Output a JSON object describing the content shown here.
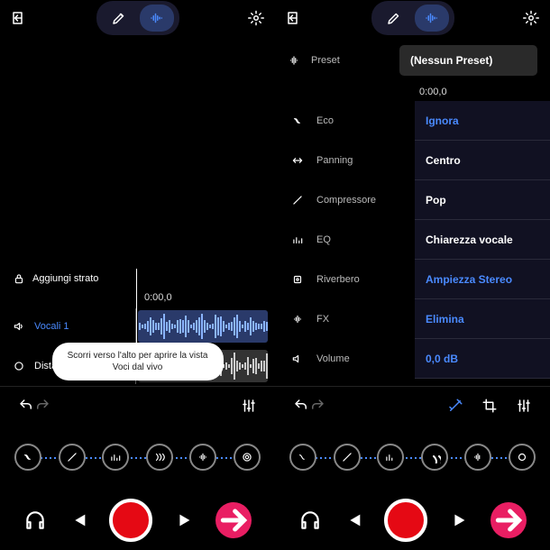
{
  "left": {
    "layer_header": "Aggiungi strato",
    "time": "0:00,0",
    "tracks": [
      {
        "name": "Vocali 1",
        "accent": true
      },
      {
        "name": "Distanza.WMA",
        "accent": false
      }
    ],
    "tooltip": "Scorri verso l'alto per aprire la vista Voci dal vivo"
  },
  "right": {
    "preset_label": "Preset",
    "preset_value": "(Nessun Preset)",
    "time": "0:00,0",
    "fx": [
      {
        "name": "Eco",
        "value": "Ignora",
        "accent": true
      },
      {
        "name": "Panning",
        "value": "Centro",
        "accent": false
      },
      {
        "name": "Compressore",
        "value": "Pop",
        "accent": false
      },
      {
        "name": "EQ",
        "value": "Chiarezza vocale",
        "accent": false
      },
      {
        "name": "Riverbero",
        "value": "Ampiezza Stereo",
        "accent": true
      },
      {
        "name": "FX",
        "value": "Elimina",
        "accent": true
      },
      {
        "name": "Volume",
        "value": "0,0 dB",
        "accent": true
      }
    ]
  }
}
